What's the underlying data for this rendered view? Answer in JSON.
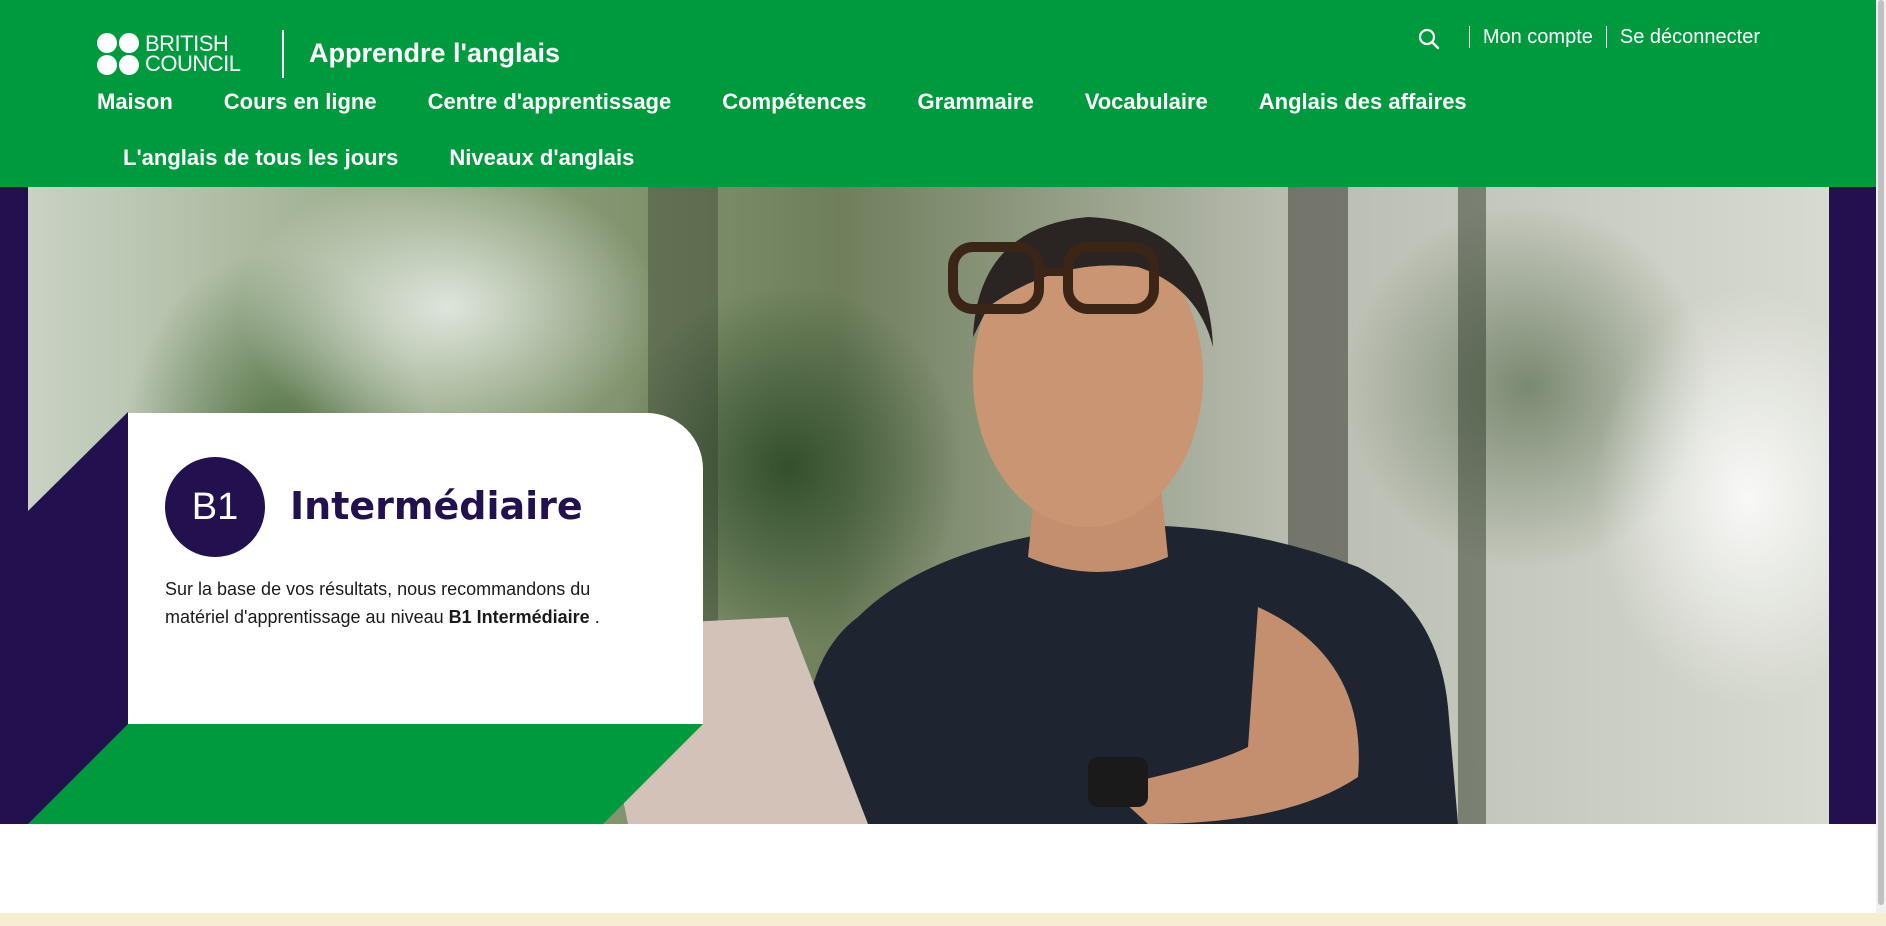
{
  "header": {
    "logo_line1": "BRITISH",
    "logo_line2": "COUNCIL",
    "site_title": "Apprendre l'anglais",
    "search_icon": "search-icon",
    "account_label": "Mon compte",
    "logout_label": "Se déconnecter",
    "brand_color": "#009a3e"
  },
  "nav": {
    "row1": [
      "Maison",
      "Cours en ligne",
      "Centre d'apprentissage",
      "Compétences",
      "Grammaire",
      "Vocabulaire",
      "Anglais des affaires"
    ],
    "row2": [
      "L'anglais de tous les jours",
      "Niveaux d'anglais"
    ]
  },
  "hero": {
    "badge": "B1",
    "level_name": "Intermédiaire",
    "desc_before": "Sur la base de vos résultats, nous recommandons du matériel d'apprentissage au  niveau ",
    "desc_strong": "B1 Intermédiaire",
    "desc_after": " .",
    "accent_color": "#23104f"
  }
}
